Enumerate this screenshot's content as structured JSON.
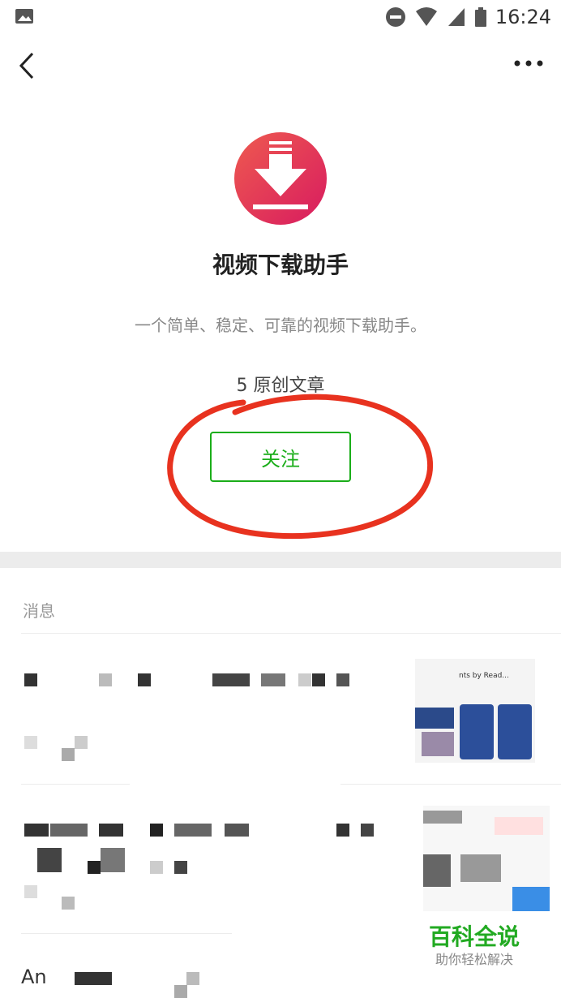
{
  "status_bar": {
    "time": "16:24"
  },
  "account": {
    "name": "视频下载助手",
    "description": "一个简单、稳定、可靠的视频下载助手。",
    "articles_count": "5 原创文章",
    "follow_label": "关注",
    "brand_color": "#e53935",
    "follow_color": "#1aad19"
  },
  "messages": {
    "section_title": "消息",
    "partial_text": "An",
    "thumb1_caption": "nts by Read..."
  },
  "watermark": {
    "title": "百科全说",
    "subtitle": "助你轻松解决"
  },
  "icons": [
    "image-icon",
    "dnd-icon",
    "wifi-icon",
    "signal-icon",
    "battery-icon",
    "back-icon",
    "more-icon",
    "download-icon"
  ]
}
